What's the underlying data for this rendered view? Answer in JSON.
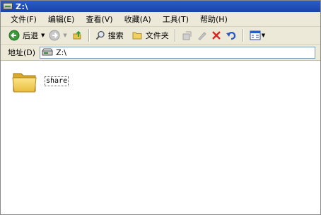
{
  "window": {
    "title": "Z:\\",
    "accent_color": "#2a5cc9"
  },
  "menu": [
    {
      "label": "文件(F)"
    },
    {
      "label": "编辑(E)"
    },
    {
      "label": "查看(V)"
    },
    {
      "label": "收藏(A)"
    },
    {
      "label": "工具(T)"
    },
    {
      "label": "帮助(H)"
    }
  ],
  "toolbar": {
    "back_label": "后退",
    "search_label": "搜索",
    "folders_label": "文件夹",
    "icons": [
      "back-arrow-icon",
      "forward-arrow-icon",
      "up-folder-icon",
      "search-icon",
      "folders-icon",
      "move-to-icon",
      "copy-to-icon",
      "delete-icon",
      "undo-icon",
      "views-icon"
    ]
  },
  "address": {
    "label": "地址(D)",
    "value": "Z:\\"
  },
  "files": [
    {
      "name": "share",
      "type": "folder",
      "icon": "folder-icon"
    }
  ]
}
